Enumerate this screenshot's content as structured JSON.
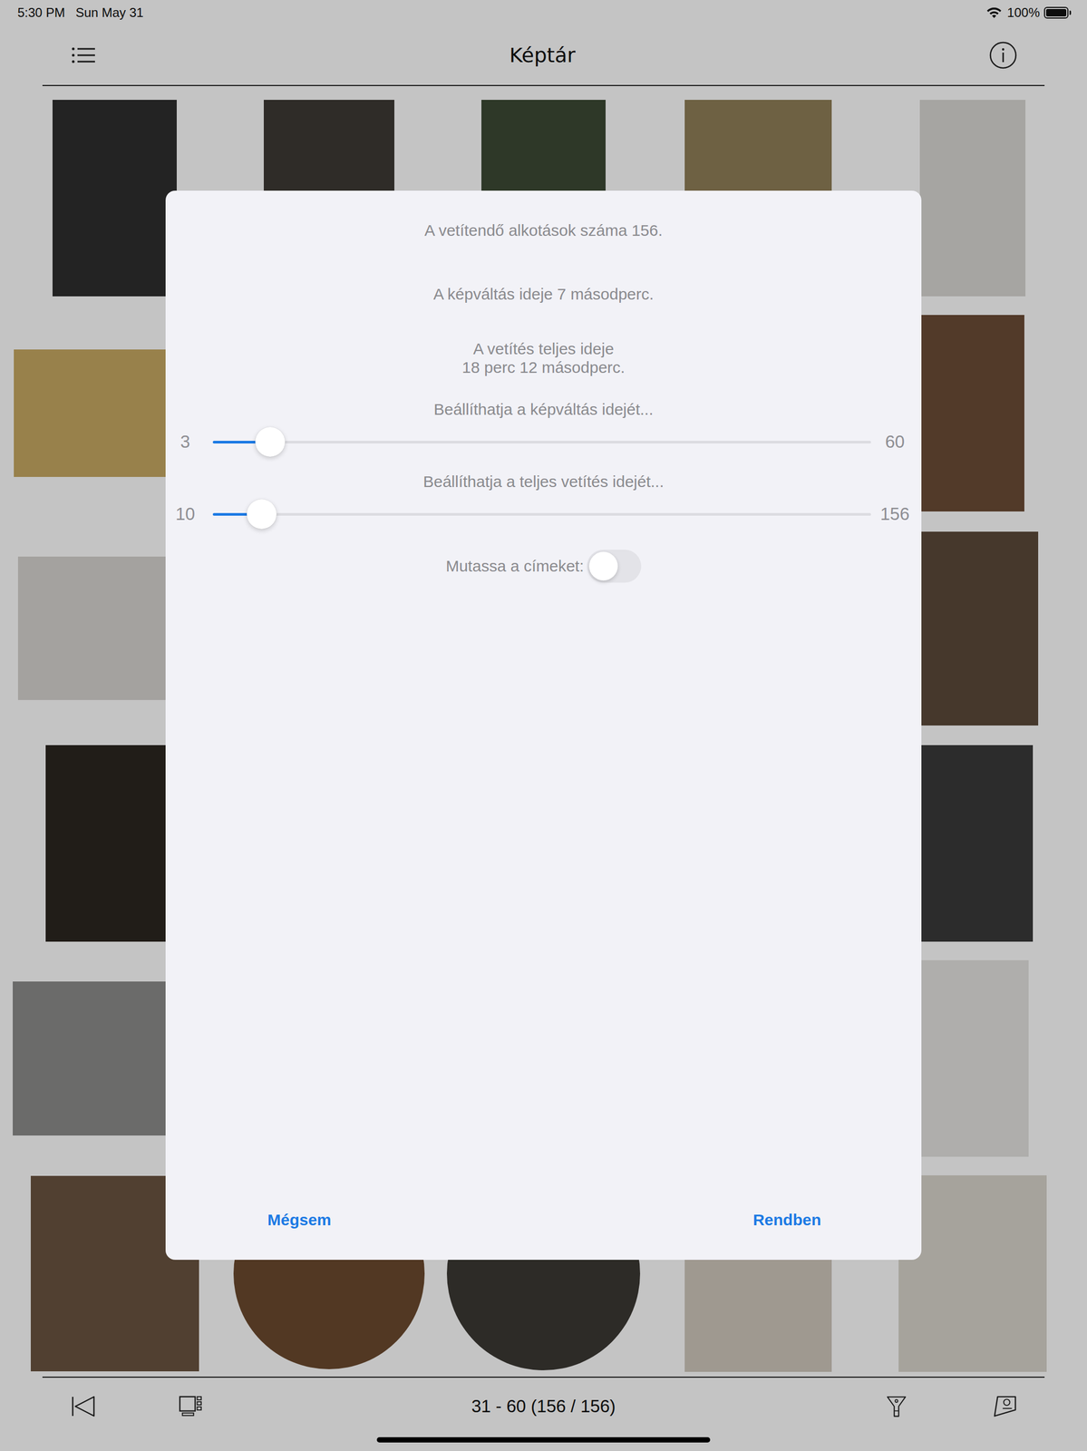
{
  "status_bar": {
    "time": "5:30 PM",
    "date": "Sun May 31",
    "battery": "100%",
    "battery_level": 1.0
  },
  "nav": {
    "title": "Képtár"
  },
  "gallery": {
    "rows": [
      [
        {
          "kind": "photo",
          "color": "#2e2e2e"
        },
        {
          "kind": "photo",
          "color": "#3e3a34"
        },
        {
          "kind": "photo",
          "color": "#3c4a34"
        },
        {
          "kind": "photo",
          "color": "#8f7f58"
        },
        {
          "kind": "photo",
          "color": "#d9d7d3"
        }
      ],
      [
        {
          "kind": "photo",
          "color": "#c6a862"
        },
        null,
        null,
        null,
        {
          "kind": "photo",
          "color": "#6b4c36"
        }
      ],
      [
        {
          "kind": "photo",
          "color": "#d6d3cf"
        },
        null,
        null,
        null,
        {
          "kind": "photo",
          "color": "#5c4a3a"
        }
      ],
      [
        {
          "kind": "photo",
          "color": "#2c2620"
        },
        null,
        null,
        null,
        {
          "kind": "photo",
          "color": "#3a3a3a"
        }
      ],
      [
        {
          "kind": "photo",
          "color": "#8c8c8a"
        },
        null,
        null,
        null,
        {
          "kind": "photo",
          "color": "#e4e3e0"
        }
      ],
      [
        {
          "kind": "photo",
          "color": "#6a5440"
        },
        {
          "kind": "medal",
          "color": "#6b4a2e"
        },
        {
          "kind": "medal",
          "color": "#3b3833"
        },
        {
          "kind": "photo",
          "color": "#cfc7bc"
        },
        {
          "kind": "photo",
          "color": "#d8d4cc"
        }
      ]
    ]
  },
  "dialog": {
    "lines": [
      "A vetítendő alkotások száma 156.",
      "A képváltás ideje 7 másodperc."
    ],
    "total": [
      "A vetítés teljes ideje",
      "18 perc 12 másodperc."
    ],
    "sliders": [
      {
        "caption": "Beállíthatja a képváltás idejét...",
        "min": "3",
        "max": "60",
        "level": 0.087
      },
      {
        "caption": "Beállíthatja a teljes vetítés idejét...",
        "min": "10",
        "max": "156",
        "level": 0.074
      }
    ],
    "toggle": {
      "label": "Mutassa a címeket:",
      "on": false
    },
    "buttons": [
      {
        "label": "Mégsem"
      },
      {
        "label": "Rendben"
      }
    ]
  },
  "toolbar": {
    "range": "31 - 60 (156 / 156)"
  }
}
